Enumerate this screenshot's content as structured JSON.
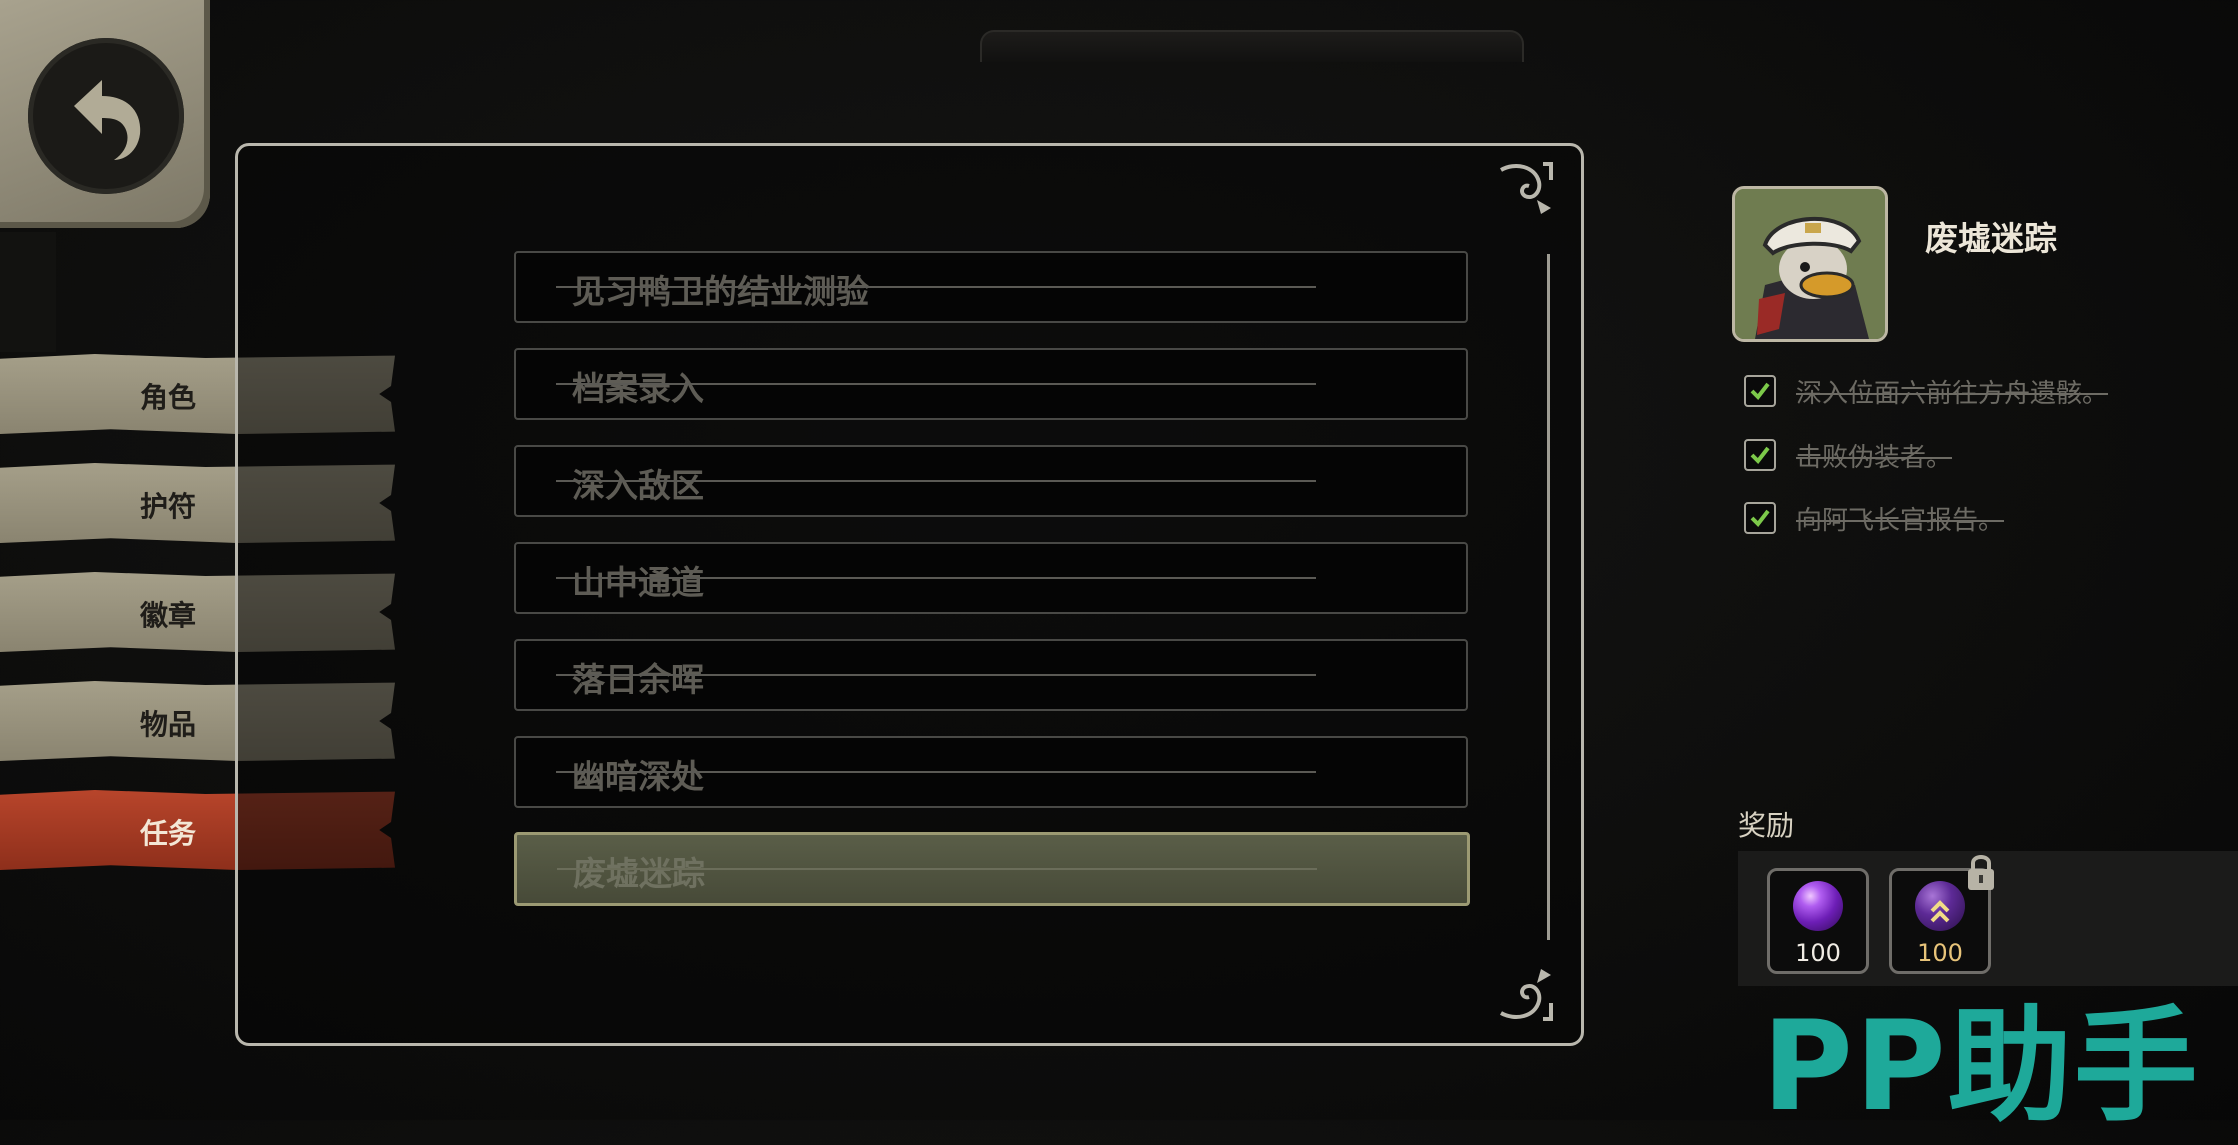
{
  "nav": {
    "back_icon": "back-arrow-icon",
    "tabs": [
      {
        "label": "角色",
        "active": false
      },
      {
        "label": "护符",
        "active": false
      },
      {
        "label": "徽章",
        "active": false
      },
      {
        "label": "物品",
        "active": false
      },
      {
        "label": "任务",
        "active": true
      }
    ]
  },
  "quests": [
    {
      "label": "见习鸭卫的结业测验",
      "completed": true,
      "selected": false
    },
    {
      "label": "档案录入",
      "completed": true,
      "selected": false
    },
    {
      "label": "深入敌区",
      "completed": true,
      "selected": false
    },
    {
      "label": "山中通道",
      "completed": true,
      "selected": false
    },
    {
      "label": "落日余晖",
      "completed": true,
      "selected": false
    },
    {
      "label": "幽暗深处",
      "completed": true,
      "selected": false
    },
    {
      "label": "废墟迷踪",
      "completed": true,
      "selected": true
    }
  ],
  "detail": {
    "title": "废墟迷踪",
    "portrait_icon": "duck-captain-portrait",
    "objectives": [
      {
        "text": "深入位面六前往方舟遗骸。",
        "checked": true
      },
      {
        "text": "击败伪装者。",
        "checked": true
      },
      {
        "text": "向阿飞长官报告。",
        "checked": true
      }
    ],
    "rewards_label": "奖励",
    "rewards": [
      {
        "icon": "purple-orb-icon",
        "count": "100",
        "locked": false
      },
      {
        "icon": "purple-orb-upgrade-icon",
        "count": "100",
        "locked": true
      }
    ]
  },
  "watermark": "PP助手",
  "colors": {
    "active_tab": "#a83c24",
    "tab": "#9c9782",
    "frame": "#b9b7ad",
    "watermark": "#1ea99a"
  }
}
